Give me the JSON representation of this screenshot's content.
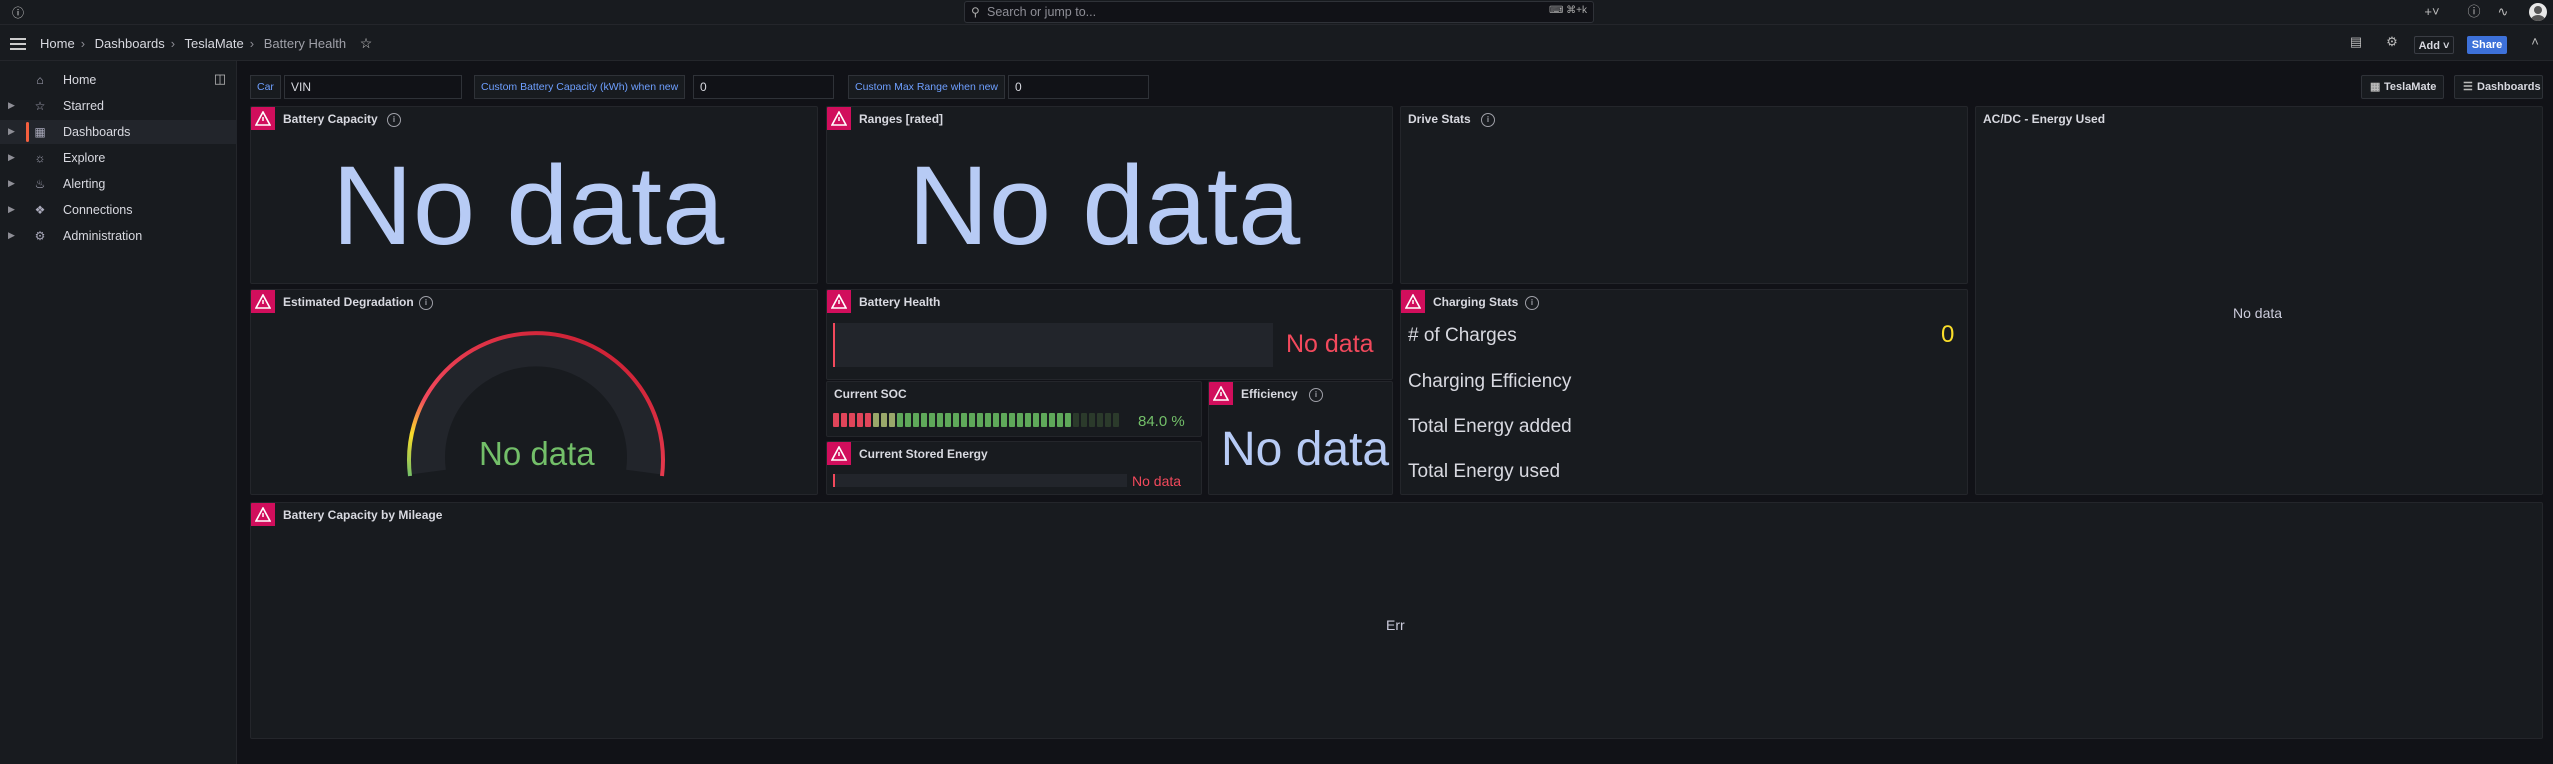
{
  "search": {
    "placeholder": "Search or jump to...",
    "shortcut": "⌘+k"
  },
  "breadcrumbs": [
    "Home",
    "Dashboards",
    "TeslaMate",
    "Battery Health"
  ],
  "toolbar": {
    "add_label": "Add",
    "share_label": "Share"
  },
  "sidebar": {
    "items": [
      {
        "label": "Home",
        "icon": "home-icon",
        "expandable": false
      },
      {
        "label": "Starred",
        "icon": "star-icon",
        "expandable": true
      },
      {
        "label": "Dashboards",
        "icon": "dashboards-icon",
        "expandable": true,
        "active": true
      },
      {
        "label": "Explore",
        "icon": "compass-icon",
        "expandable": true
      },
      {
        "label": "Alerting",
        "icon": "bell-icon",
        "expandable": true
      },
      {
        "label": "Connections",
        "icon": "connections-icon",
        "expandable": true
      },
      {
        "label": "Administration",
        "icon": "gear-icon",
        "expandable": true
      }
    ]
  },
  "variables": [
    {
      "label": "Car",
      "value": "VIN"
    },
    {
      "label": "Custom Battery Capacity (kWh) when new",
      "value": "0"
    },
    {
      "label": "Custom Max Range when new",
      "value": "0"
    }
  ],
  "dashboard_links": [
    "TeslaMate",
    "Dashboards"
  ],
  "panels": {
    "battery_capacity": {
      "title": "Battery Capacity",
      "value": "No data"
    },
    "ranges": {
      "title": "Ranges [rated]",
      "value": "No data"
    },
    "drive_stats": {
      "title": "Drive Stats"
    },
    "acdc": {
      "title": "AC/DC - Energy Used",
      "value": "No data"
    },
    "degradation": {
      "title": "Estimated Degradation",
      "value": "No data"
    },
    "battery_health": {
      "title": "Battery Health",
      "value": "No data"
    },
    "current_soc": {
      "title": "Current SOC",
      "value": "84.0 %",
      "level": 0.84
    },
    "stored_energy": {
      "title": "Current Stored Energy",
      "value": "No data"
    },
    "efficiency": {
      "title": "Efficiency",
      "value": "No data"
    },
    "charging_stats": {
      "title": "Charging Stats",
      "rows": [
        {
          "label": "# of Charges",
          "value": "0"
        },
        {
          "label": "Charging Efficiency",
          "value": ""
        },
        {
          "label": "Total Energy added",
          "value": ""
        },
        {
          "label": "Total Energy used",
          "value": ""
        }
      ]
    },
    "capacity_by_mileage": {
      "title": "Battery Capacity by Mileage",
      "value": "Err"
    }
  },
  "colors": {
    "error_corner": "#d10e5c",
    "nodata_blue": "#b7cbf5",
    "green": "#73bf69",
    "red": "#f2495c",
    "yellow": "#fade2a",
    "share_blue": "#3d71d9",
    "active_orange": "#f55f3e"
  }
}
